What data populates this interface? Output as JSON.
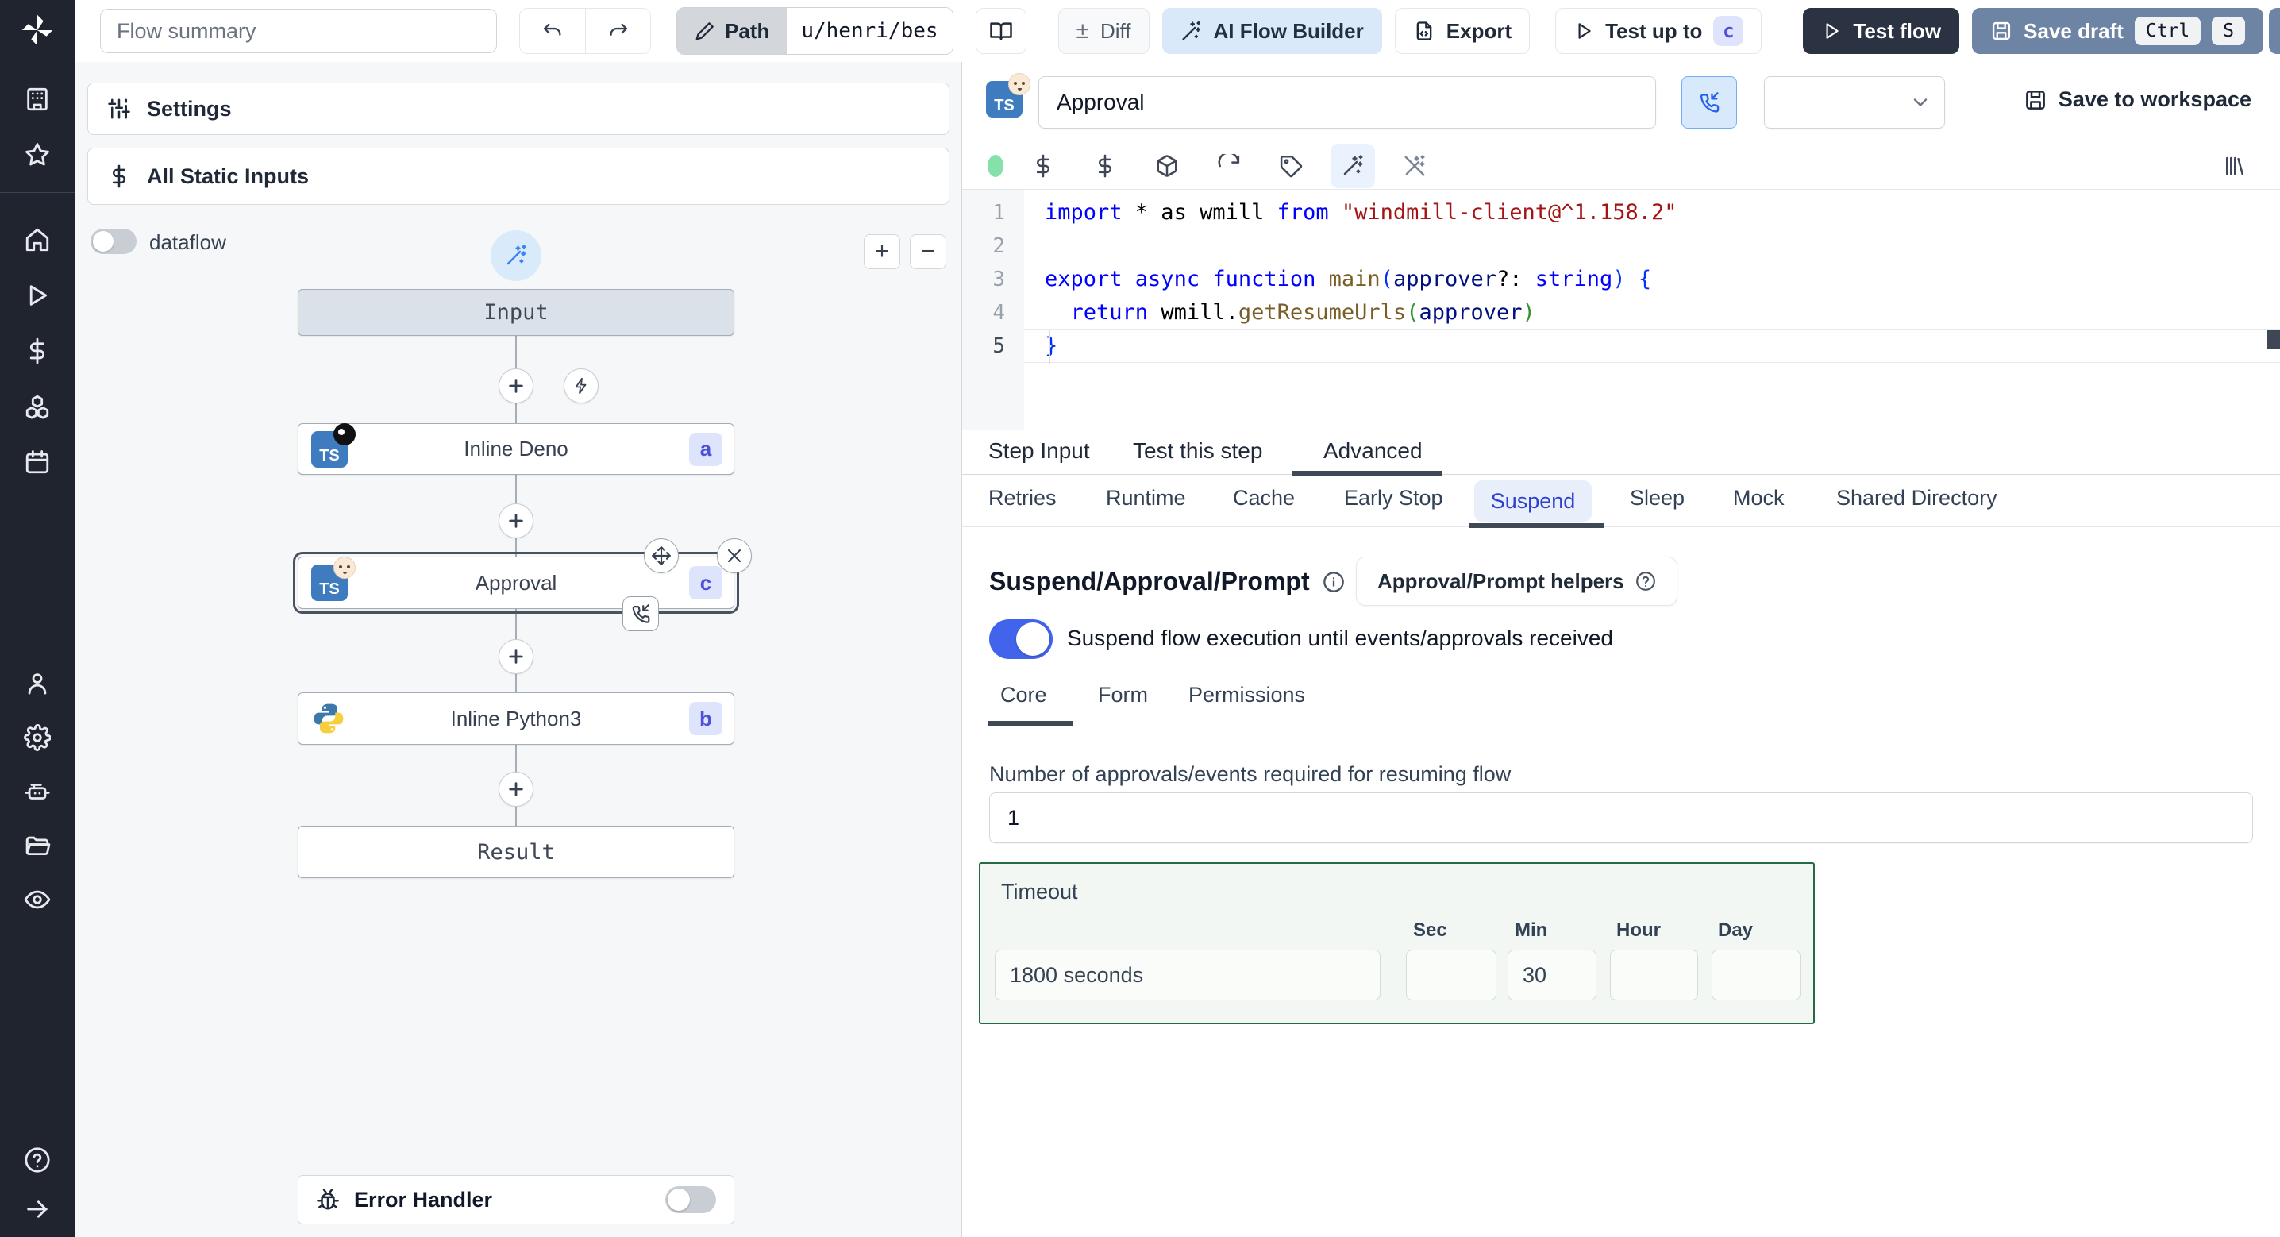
{
  "topbar": {
    "flow_summary_placeholder": "Flow summary",
    "path_label": "Path",
    "path_value": "u/henri/bes",
    "diff_label": "Diff",
    "diff_glyph": "±",
    "ai_flow_builder_label": "AI Flow Builder",
    "export_label": "Export",
    "test_up_to_label": "Test up to",
    "test_up_to_badge": "c",
    "test_flow_label": "Test flow",
    "save_draft_label": "Save draft",
    "save_draft_kbd_1": "Ctrl",
    "save_draft_kbd_2": "S"
  },
  "flow_panel": {
    "settings_label": "Settings",
    "static_inputs_label": "All Static Inputs",
    "dataflow_label": "dataflow",
    "zoom_in_glyph": "+",
    "zoom_out_glyph": "−",
    "nodes": {
      "input": {
        "label": "Input"
      },
      "deno": {
        "label": "Inline Deno",
        "badge": "a",
        "lang": "TS"
      },
      "approval": {
        "label": "Approval",
        "badge": "c",
        "lang": "TS"
      },
      "python": {
        "label": "Inline Python3",
        "badge": "b"
      },
      "result": {
        "label": "Result"
      }
    },
    "error_handler_label": "Error Handler"
  },
  "editor": {
    "title_value": "Approval",
    "lang_badge": "TS",
    "save_to_workspace_label": "Save to workspace"
  },
  "code": {
    "active_line": 5,
    "lines": [
      [
        {
          "t": "import ",
          "c": "kw"
        },
        {
          "t": "* as wmill ",
          "c": "pl"
        },
        {
          "t": "from ",
          "c": "kw"
        },
        {
          "t": "\"windmill-client@^1.158.2\"",
          "c": "str"
        }
      ],
      [],
      [
        {
          "t": "export ",
          "c": "kw"
        },
        {
          "t": "async ",
          "c": "kw"
        },
        {
          "t": "function ",
          "c": "kw"
        },
        {
          "t": "main",
          "c": "fn"
        },
        {
          "t": "(",
          "c": "b1"
        },
        {
          "t": "approver",
          "c": "param"
        },
        {
          "t": "?: ",
          "c": "pl"
        },
        {
          "t": "string",
          "c": "kw"
        },
        {
          "t": ")",
          "c": "b1"
        },
        {
          "t": " ",
          "c": "pl"
        },
        {
          "t": "{",
          "c": "b1"
        }
      ],
      [
        {
          "t": "  ",
          "c": "pl"
        },
        {
          "t": "return",
          "c": "kw"
        },
        {
          "t": " wmill.",
          "c": "pl"
        },
        {
          "t": "getResumeUrls",
          "c": "fn"
        },
        {
          "t": "(",
          "c": "b2"
        },
        {
          "t": "approver",
          "c": "param"
        },
        {
          "t": ")",
          "c": "b2"
        }
      ],
      [
        {
          "t": "}",
          "c": "b1"
        }
      ]
    ]
  },
  "tabs": {
    "step": [
      {
        "label": "Step Input"
      },
      {
        "label": "Test this step"
      },
      {
        "label": "Advanced",
        "active": true
      }
    ],
    "advanced": [
      {
        "label": "Retries"
      },
      {
        "label": "Runtime"
      },
      {
        "label": "Cache"
      },
      {
        "label": "Early Stop"
      },
      {
        "label": "Suspend",
        "active": true
      },
      {
        "label": "Sleep"
      },
      {
        "label": "Mock"
      },
      {
        "label": "Shared Directory"
      }
    ],
    "suspend_sections": [
      {
        "label": "Core",
        "active": true
      },
      {
        "label": "Form"
      },
      {
        "label": "Permissions"
      }
    ]
  },
  "suspend": {
    "heading": "Suspend/Approval/Prompt",
    "helpers_button_label": "Approval/Prompt helpers",
    "toggle_label": "Suspend flow execution until events/approvals received",
    "toggle_on": true,
    "approvals_label": "Number of approvals/events required for resuming flow",
    "approvals_value": "1",
    "timeout": {
      "label": "Timeout",
      "value": "1800 seconds",
      "units": [
        {
          "label": "Sec",
          "value": ""
        },
        {
          "label": "Min",
          "value": "30"
        },
        {
          "label": "Hour",
          "value": ""
        },
        {
          "label": "Day",
          "value": ""
        }
      ]
    }
  },
  "colors": {
    "accent_toggle_blue": "#4263eb",
    "suspend_tab_blue": "#2c41cd",
    "save_draft_button": "#6d84a4",
    "test_flow_button": "#2b3342",
    "ai_builder_bg": "#d9e9f9",
    "timeout_border_green": "#256b42",
    "timeout_bg_green": "#f2f7f3",
    "step_badge_bg": "#dfe4fd",
    "step_badge_text": "#4d51d8",
    "status_dot_green": "#84e1a8",
    "input_node_bg": "#dbe1e9",
    "sidebar_bg": "#20242f"
  }
}
